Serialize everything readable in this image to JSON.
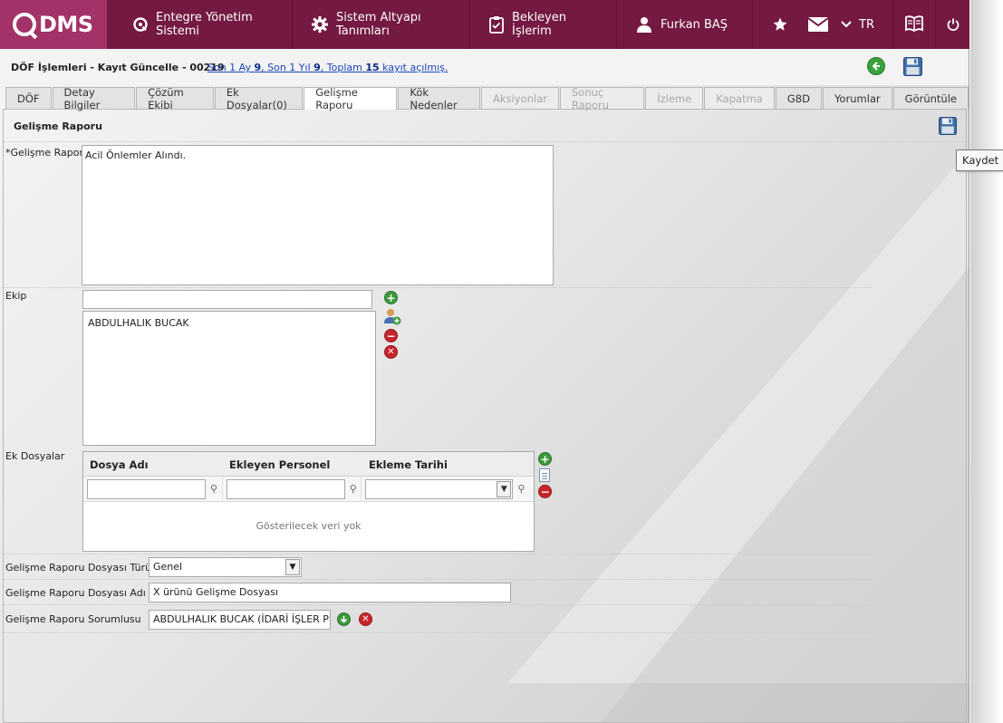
{
  "app": {
    "logo_text": "DMS",
    "nav": [
      {
        "label": "Entegre Yönetim Sistemi",
        "icon": "q-logo-icon"
      },
      {
        "label": "Sistem Altyapı Tanımları",
        "icon": "gear-icon"
      },
      {
        "label": "Bekleyen İşlerim",
        "icon": "clipboard-icon"
      },
      {
        "label": "Furkan BAŞ",
        "icon": "user-icon"
      }
    ],
    "language": "TR"
  },
  "header": {
    "title": "DÖF İşlemleri - Kayıt Güncelle - 00219",
    "record_link": {
      "prefix": "Son 1 Ay ",
      "month": "9",
      "mid": ", Son 1 Yıl ",
      "year": "9",
      "mid2": ", Toplam ",
      "total": "15",
      "suffix": " kayıt açılmış."
    }
  },
  "tabs": [
    {
      "label": "DÖF",
      "state": "normal"
    },
    {
      "label": "Detay Bilgiler",
      "state": "normal"
    },
    {
      "label": "Çözüm Ekibi",
      "state": "normal"
    },
    {
      "label": "Ek Dosyalar(0)",
      "state": "normal"
    },
    {
      "label": "Gelişme Raporu",
      "state": "active"
    },
    {
      "label": "Kök Nedenler",
      "state": "normal"
    },
    {
      "label": "Aksiyonlar",
      "state": "disabled"
    },
    {
      "label": "Sonuç Raporu",
      "state": "disabled"
    },
    {
      "label": "İzleme",
      "state": "disabled"
    },
    {
      "label": "Kapatma",
      "state": "disabled"
    },
    {
      "label": "G8D",
      "state": "normal"
    },
    {
      "label": "Yorumlar",
      "state": "normal"
    },
    {
      "label": "Görüntüle",
      "state": "normal"
    }
  ],
  "panel": {
    "title": "Gelişme Raporu",
    "tooltip": "Kaydet",
    "report": {
      "label": "*Gelişme Raporu",
      "value": "Acil Önlemler Alındı."
    },
    "team": {
      "label": "Ekip",
      "input_value": "",
      "members": [
        "ABDULHALIK BUCAK"
      ]
    },
    "files": {
      "label": "Ek Dosyalar",
      "columns": [
        "Dosya Adı",
        "Ekleyen Personel",
        "Ekleme Tarihi"
      ],
      "empty_text": "Gösterilecek veri yok"
    },
    "file_type": {
      "label": "Gelişme Raporu Dosyası Türü",
      "value": "Genel"
    },
    "file_name": {
      "label": "Gelişme Raporu Dosyası Adı",
      "value": "X ürünü Gelişme Dosyası"
    },
    "responsible": {
      "label": "Gelişme Raporu Sorumlusu",
      "value": "ABDULHALIK BUCAK (İDARİ İŞLER PER"
    }
  },
  "colors": {
    "topbar": "#741942",
    "logo_bg": "#a33268",
    "link": "#1a45b8",
    "add": "#3d9a3d",
    "remove": "#c8252b"
  }
}
